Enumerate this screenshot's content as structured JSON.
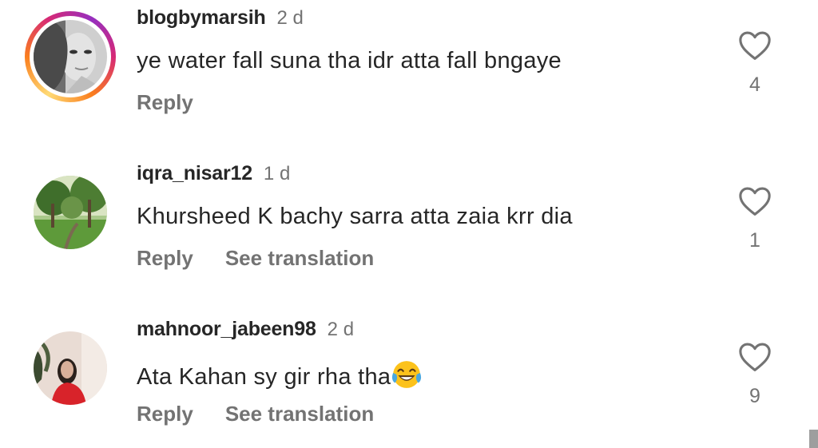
{
  "comments": [
    {
      "username": "blogbymarsih",
      "time": "2 d",
      "text": "ye water fall suna tha idr atta fall bngaye",
      "reply_label": "Reply",
      "likes": "4",
      "has_story_ring": true
    },
    {
      "username": "iqra_nisar12",
      "time": "1 d",
      "text": "Khursheed  K  bachy sarra atta zaia krr dia",
      "reply_label": "Reply",
      "translate_label": "See translation",
      "likes": "1"
    },
    {
      "username": "mahnoor_jabeen98",
      "time": "2 d",
      "text": "Ata Kahan sy gir rha tha",
      "emoji": "face-with-tears-of-joy",
      "reply_label": "Reply",
      "translate_label": "See translation",
      "likes": "9"
    }
  ],
  "icons": {
    "like": "heart-outline-icon"
  },
  "colors": {
    "text_primary": "#262626",
    "text_secondary": "#737373",
    "story_ring": [
      "#feda75",
      "#fa7e1e",
      "#d62976",
      "#962fbf"
    ]
  }
}
